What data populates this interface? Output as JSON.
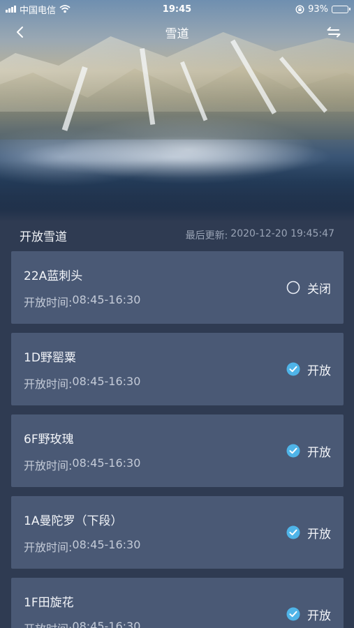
{
  "status_bar": {
    "carrier": "中国电信",
    "time": "19:45",
    "battery": "93%",
    "battery_level": 0.93
  },
  "nav": {
    "title": "雪道"
  },
  "section": {
    "title": "开放雪道",
    "updated_label": "最后更新:",
    "updated_time": "2020-12-20 19:45:47"
  },
  "runs": [
    {
      "name": "22A蓝刺头",
      "hours_label": "开放时间:",
      "hours": "08:45-16:30",
      "status": "关闭",
      "open": false
    },
    {
      "name": "1D野罂粟",
      "hours_label": "开放时间:",
      "hours": "08:45-16:30",
      "status": "开放",
      "open": true
    },
    {
      "name": "6F野玫瑰",
      "hours_label": "开放时间:",
      "hours": "08:45-16:30",
      "status": "开放",
      "open": true
    },
    {
      "name": "1A曼陀罗（下段）",
      "hours_label": "开放时间:",
      "hours": "08:45-16:30",
      "status": "开放",
      "open": true
    },
    {
      "name": "1F田旋花",
      "hours_label": "开放时间:",
      "hours": "08:45-16:30",
      "status": "开放",
      "open": true
    }
  ],
  "colors": {
    "open_check": "#4fb4e8",
    "card_bg": "#4a5975",
    "page_bg": "#2f3b52"
  },
  "icons": {
    "back": "chevron-left-icon",
    "switch": "switch-arrows-icon",
    "open": "check-circle-icon",
    "closed": "empty-circle-icon"
  }
}
